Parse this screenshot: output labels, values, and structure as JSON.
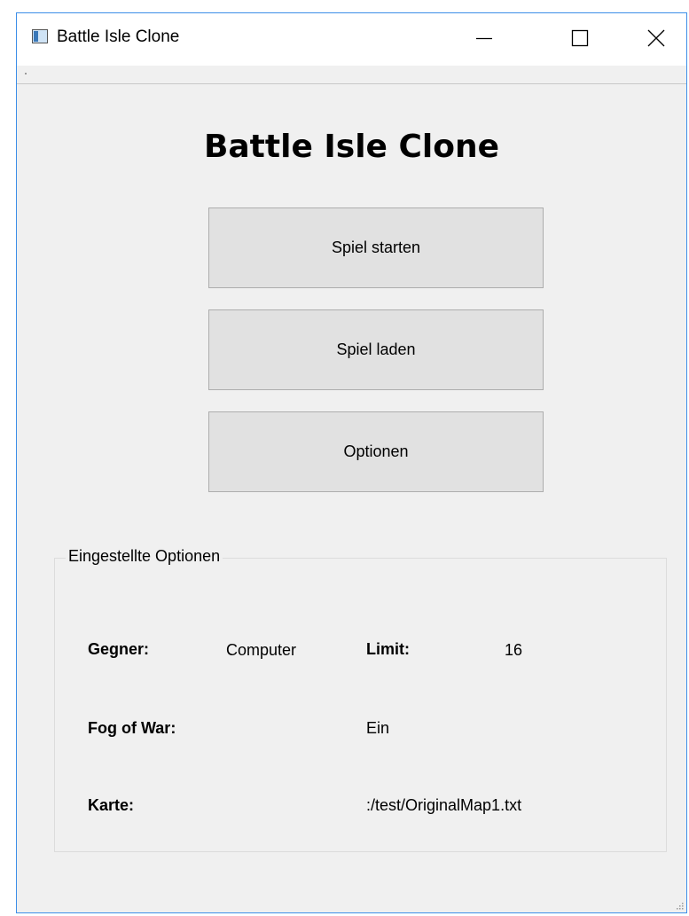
{
  "window": {
    "title": "Battle Isle Clone",
    "icon": "application-window-icon",
    "controls": [
      "minimize-icon",
      "maximize-icon",
      "close-icon"
    ]
  },
  "main": {
    "heading": "Battle Isle Clone",
    "buttons": {
      "start": "Spiel starten",
      "load": "Spiel laden",
      "options": "Optionen"
    }
  },
  "settings": {
    "group_title": "Eingestellte Optionen",
    "opponent_label": "Gegner:",
    "opponent_value": "Computer",
    "limit_label": "Limit:",
    "limit_value": "16",
    "fog_label": "Fog of War:",
    "fog_value": "Ein",
    "map_label": "Karte:",
    "map_value": ":/test/OriginalMap1.txt"
  }
}
